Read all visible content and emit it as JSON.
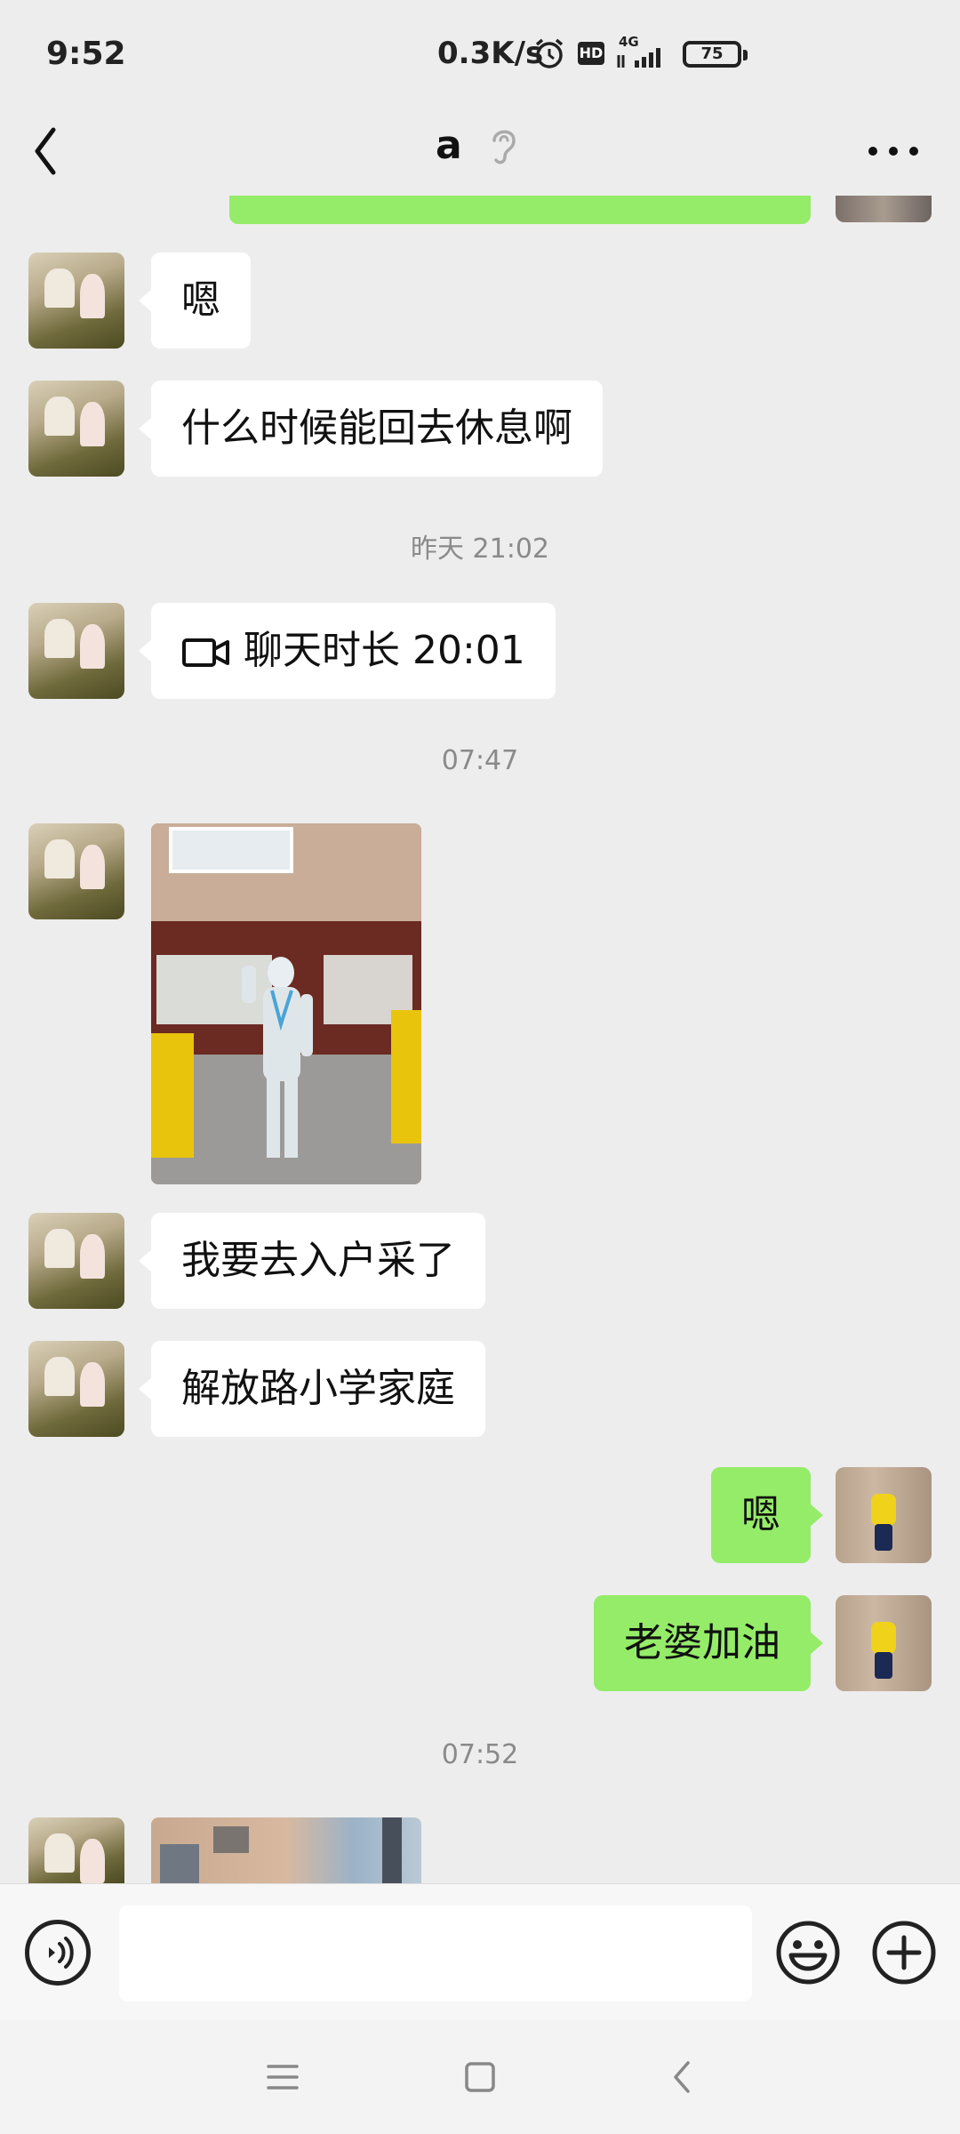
{
  "status_bar": {
    "time": "9:52",
    "net_speed": "0.3K/s",
    "hd_label": "HD",
    "network": "4G",
    "battery": "75"
  },
  "header": {
    "title": "a",
    "icons": [
      "back-chevron-icon",
      "ear-icon",
      "more-dots-icon"
    ]
  },
  "messages": [
    {
      "side": "left",
      "type": "text",
      "text": "嗯"
    },
    {
      "side": "left",
      "type": "text",
      "text": "什么时候能回去休息啊"
    },
    {
      "side": "system",
      "type": "time",
      "text": "昨天 21:02"
    },
    {
      "side": "left",
      "type": "call",
      "text": "聊天时长 20:01"
    },
    {
      "side": "system",
      "type": "time",
      "text": "07:47"
    },
    {
      "side": "left",
      "type": "image",
      "icon": "photo-person-in-protective-suit"
    },
    {
      "side": "left",
      "type": "text",
      "text": "我要去入户采了"
    },
    {
      "side": "left",
      "type": "text",
      "text": "解放路小学家庭"
    },
    {
      "side": "right",
      "type": "text",
      "text": "嗯"
    },
    {
      "side": "right",
      "type": "text",
      "text": "老婆加油"
    },
    {
      "side": "system",
      "type": "time",
      "text": "07:52"
    },
    {
      "side": "left",
      "type": "image",
      "icon": "photo-building"
    }
  ],
  "input_bar": {
    "placeholder": "",
    "icons": [
      "voice-icon",
      "emoji-icon",
      "plus-icon"
    ]
  },
  "nav_bar": {
    "icons": [
      "menu-icon",
      "home-square-icon",
      "back-triangle-icon"
    ]
  },
  "colors": {
    "background": "#ededed",
    "self_bubble": "#95ec69",
    "other_bubble": "#ffffff"
  }
}
